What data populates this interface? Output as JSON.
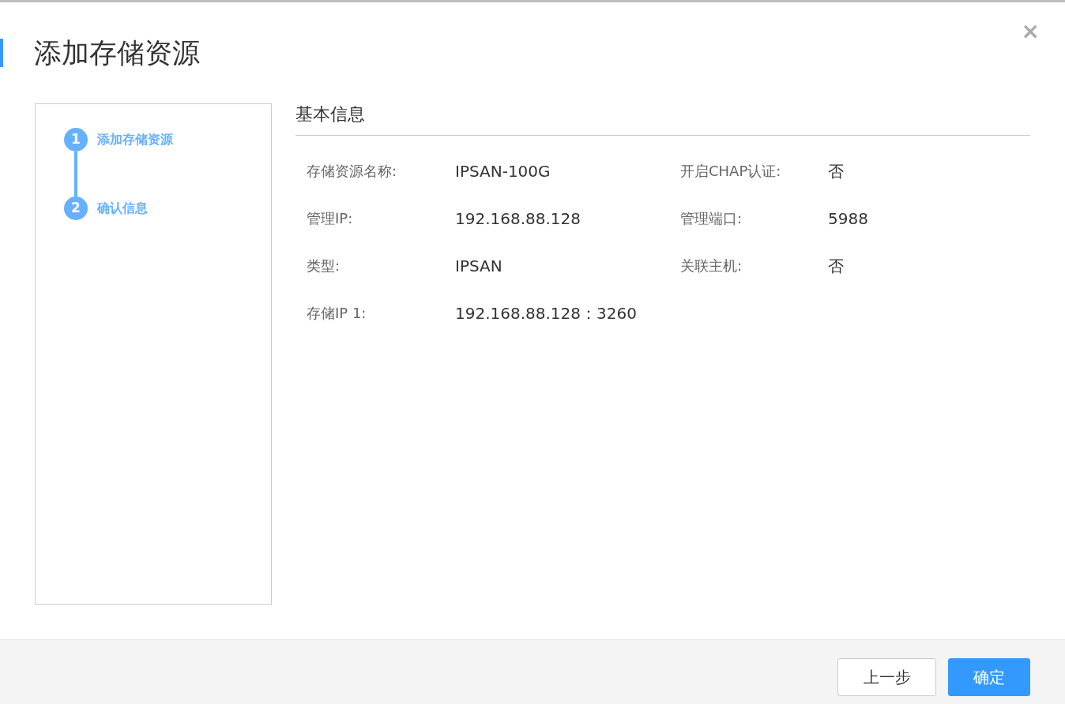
{
  "dialog": {
    "title": "添加存储资源",
    "close": "×"
  },
  "steps": [
    {
      "number": "1",
      "label": "添加存储资源",
      "active": true
    },
    {
      "number": "2",
      "label": "确认信息",
      "active": true
    }
  ],
  "section": {
    "title": "基本信息"
  },
  "fields": [
    {
      "label": "存储资源名称:",
      "value": "IPSAN-100G"
    },
    {
      "label": "开启CHAP认证:",
      "value": "否"
    },
    {
      "label": "管理IP:",
      "value": "192.168.88.128"
    },
    {
      "label": "管理端口:",
      "value": "5988"
    },
    {
      "label": "类型:",
      "value": "IPSAN"
    },
    {
      "label": "关联主机:",
      "value": "否"
    },
    {
      "label": "存储IP 1:",
      "value": "192.168.88.128：3260"
    }
  ],
  "buttons": [
    {
      "label": "上一步",
      "kind": "secondary"
    },
    {
      "label": "确定",
      "kind": "primary"
    }
  ]
}
